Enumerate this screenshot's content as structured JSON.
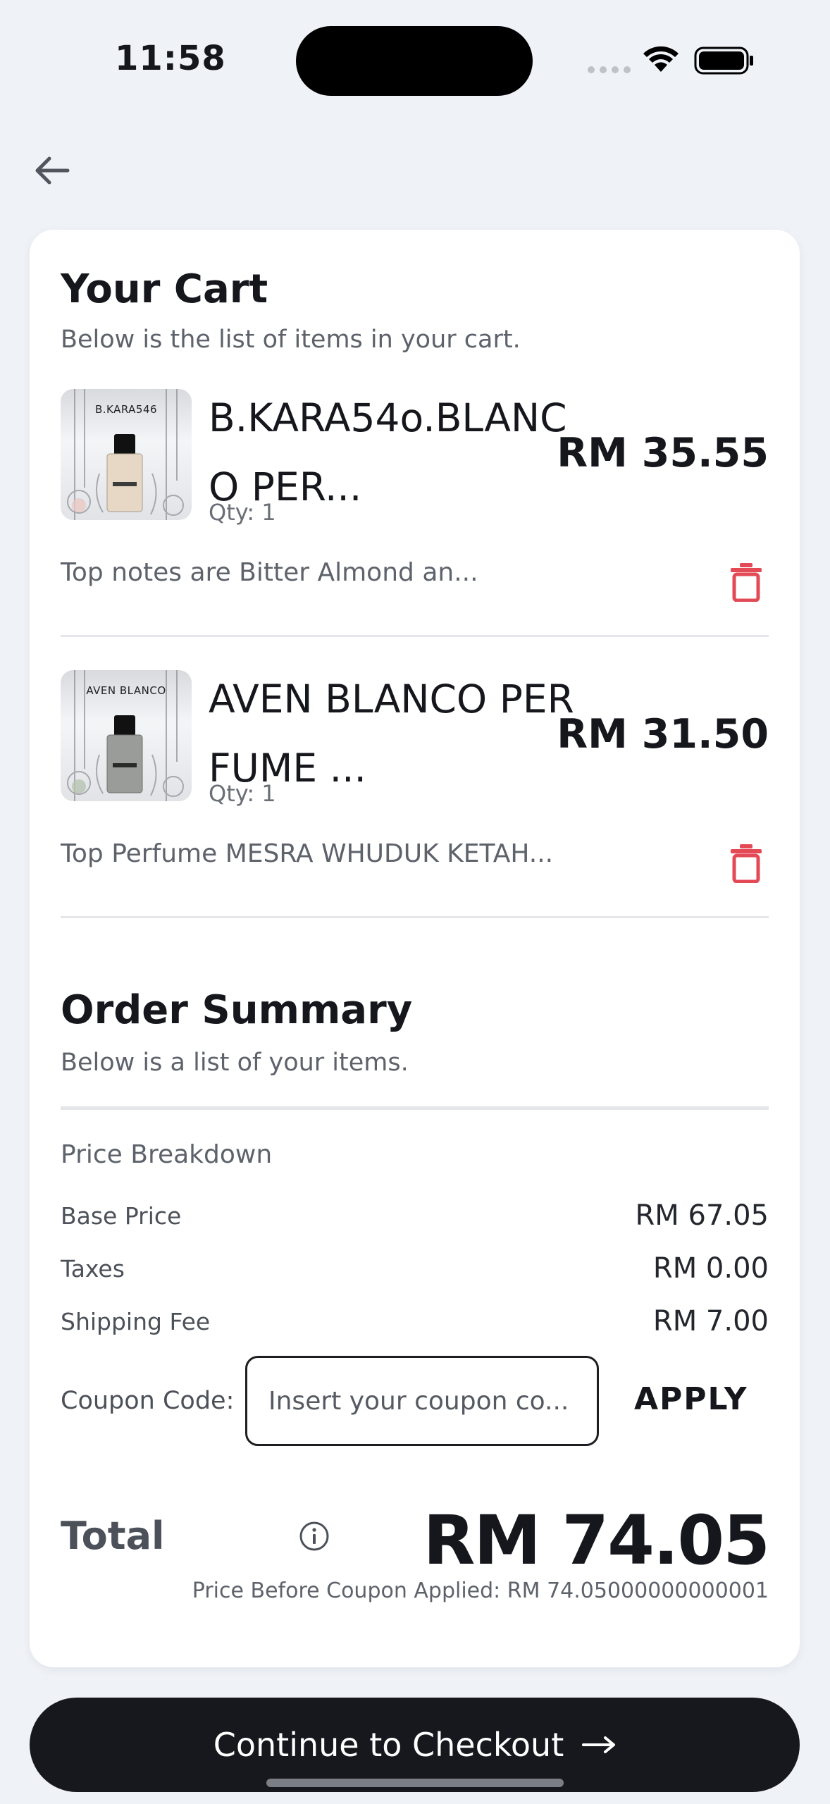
{
  "status_bar": {
    "time": "11:58"
  },
  "cart": {
    "title": "Your Cart",
    "subtitle": "Below is the list of items in your cart.",
    "items": [
      {
        "thumb_label": "B.KARA546",
        "name": "B.KARA54o.BLANCO PER...",
        "qty": "Qty: 1",
        "price": "RM 35.55",
        "description": "Top notes are Bitter Almond an..."
      },
      {
        "thumb_label": "AVEN BLANCO",
        "name": "AVEN BLANCO PERFUME ...",
        "qty": "Qty: 1",
        "price": "RM 31.50",
        "description": "Top Perfume MESRA WHUDUK KETAH..."
      }
    ]
  },
  "summary": {
    "title": "Order Summary",
    "subtitle": "Below is a list of your items.",
    "breakdown_title": "Price Breakdown",
    "rows": [
      {
        "label": "Base Price",
        "value": "RM 67.05"
      },
      {
        "label": "Taxes",
        "value": "RM 0.00"
      },
      {
        "label": "Shipping Fee",
        "value": "RM 7.00"
      }
    ],
    "coupon_label": "Coupon Code:",
    "coupon_placeholder": "Insert your coupon co...",
    "apply_label": "APPLY",
    "total_label": "Total",
    "total_value": "RM 74.05",
    "price_before_coupon": "Price Before Coupon Applied: RM 74.05000000000001"
  },
  "checkout_label": "Continue to Checkout",
  "colors": {
    "trash": "#e34a56",
    "button": "#16181d",
    "background": "#eff2f7"
  }
}
